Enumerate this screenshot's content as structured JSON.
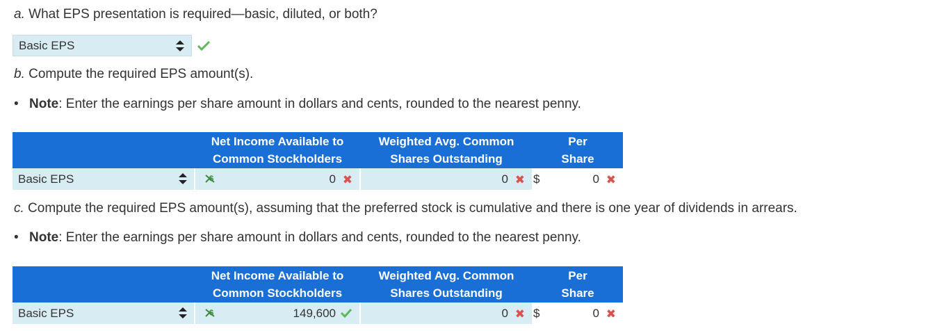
{
  "part_a": {
    "letter": "a.",
    "question": " What EPS presentation is required—basic, diluted, or both?",
    "select_value": "Basic EPS"
  },
  "part_b": {
    "letter": "b.",
    "question": " Compute the required EPS amount(s).",
    "note_label": "Note",
    "note_text": ": Enter the earnings per share amount in dollars and cents, rounded to the nearest penny.",
    "table": {
      "col1_line1": "Net Income Available to",
      "col1_line2": "Common Stockholders",
      "col2_line1": "Weighted Avg. Common",
      "col2_line2": "Shares Outstanding",
      "col3_line1": "Per",
      "col3_line2": "Share",
      "row_label": "Basic EPS",
      "net_income": "0",
      "weighted_shares": "0",
      "currency": "$",
      "per_share": "0"
    }
  },
  "part_c": {
    "letter": "c.",
    "question": " Compute the required EPS amount(s), assuming that the preferred stock is cumulative and there is one year of dividends in arrears.",
    "note_label": "Note",
    "note_text": ": Enter the earnings per share amount in dollars and cents, rounded to the nearest penny.",
    "table": {
      "col1_line1": "Net Income Available to",
      "col1_line2": "Common Stockholders",
      "col2_line1": "Weighted Avg. Common",
      "col2_line2": "Shares Outstanding",
      "col3_line1": "Per",
      "col3_line2": "Share",
      "row_label": "Basic EPS",
      "net_income": "149,600",
      "weighted_shares": "0",
      "currency": "$",
      "per_share": "0"
    }
  },
  "colors": {
    "header_blue": "#1a6fd6",
    "input_bg": "#d8ecf4",
    "correct_green": "#5cb85c",
    "wrong_red": "#d9534f"
  }
}
